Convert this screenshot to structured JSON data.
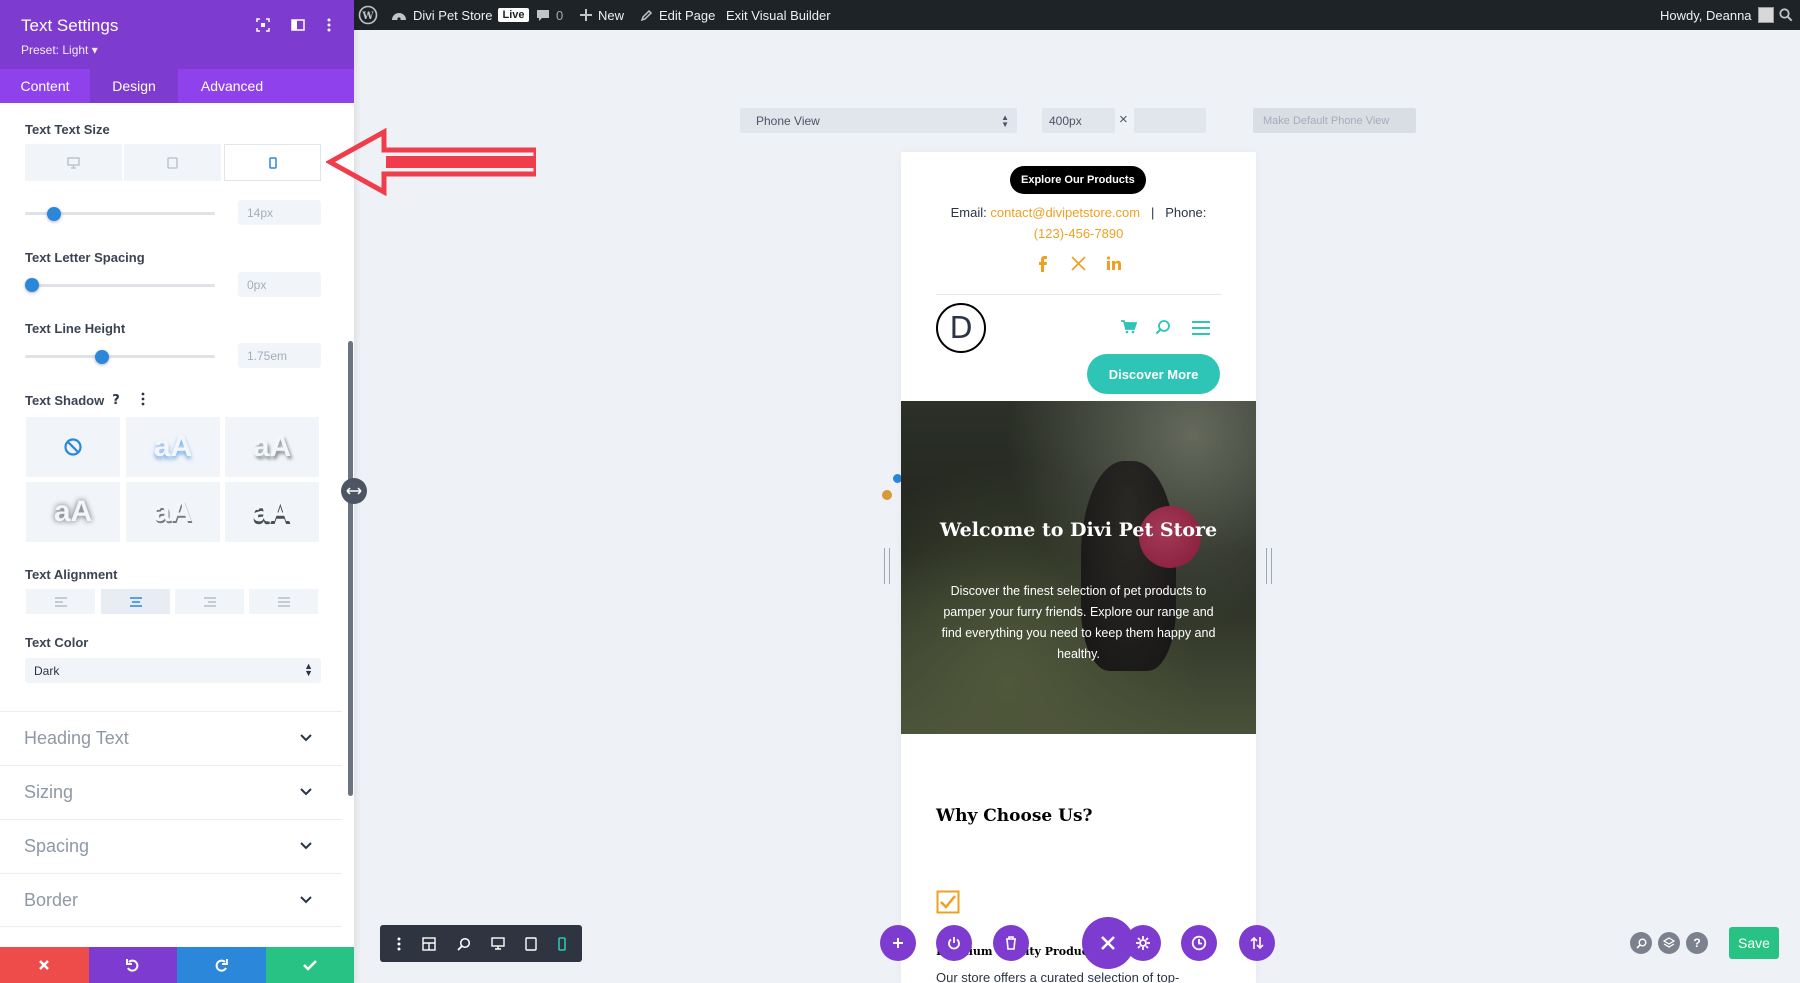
{
  "adminbar": {
    "site_name": "Divi Pet Store",
    "live_badge": "Live",
    "comments_count": "0",
    "new_label": "New",
    "edit_page_label": "Edit Page",
    "exit_label": "Exit Visual Builder",
    "howdy": "Howdy, Deanna"
  },
  "panel": {
    "title": "Text Settings",
    "preset": "Preset: Light",
    "tabs": [
      "Content",
      "Design",
      "Advanced"
    ],
    "active_tab": "Design",
    "text_size": {
      "label": "Text Text Size",
      "value": "14px",
      "level": 0.2
    },
    "letter_spacing": {
      "label": "Text Letter Spacing",
      "value": "0px",
      "level": 0.0
    },
    "line_height": {
      "label": "Text Line Height",
      "value": "1.75em",
      "level": 0.4
    },
    "text_shadow_label": "Text Shadow",
    "shadow_sample": "aA",
    "text_alignment_label": "Text Alignment",
    "text_color_label": "Text Color",
    "text_color_value": "Dark",
    "sections": [
      "Heading Text",
      "Sizing",
      "Spacing",
      "Border"
    ]
  },
  "canvas": {
    "view_select": "Phone View",
    "width_value": "400px",
    "times": "×",
    "make_default": "Make Default Phone View"
  },
  "phone": {
    "explore_button": "Explore Our Products",
    "email_label": "Email: ",
    "email": "contact@divipetstore.com",
    "separator": "|",
    "phone_label": "Phone:",
    "phone_number": "(123)-456-7890",
    "logo_letter": "D",
    "discover_button": "Discover More",
    "hero_title": "Welcome to Divi Pet Store",
    "hero_text": "Discover the finest selection of pet products to pamper your furry friends. Explore our range and find everything you need to keep them happy and healthy.",
    "why_title": "Why Choose Us?",
    "feature_title": "Premium Quality Products",
    "feature_text": "Our store offers a curated selection of top-"
  },
  "bottom": {
    "save_label": "Save"
  },
  "colors": {
    "purple": "#7e3bd0",
    "tab_bg": "#8f42ec",
    "accent_blue": "#2b87da",
    "orange": "#f0a020",
    "teal": "#2ec4b6",
    "red": "#ee4b4b",
    "green": "#29c285",
    "arrow_red": "#ef3d4c"
  }
}
